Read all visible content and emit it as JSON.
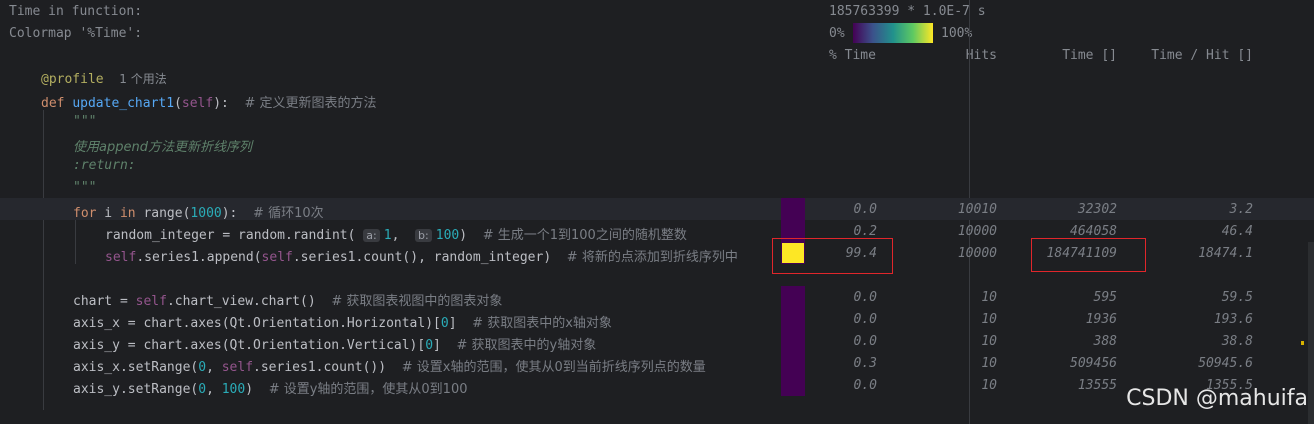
{
  "header": {
    "time_label": "Time in function:",
    "time_value": "185763399 * 1.0E-7 s",
    "colormap_label": "Colormap '%Time':",
    "colormap_min": "0%",
    "colormap_max": "100%"
  },
  "columns": [
    "% Time",
    "Hits",
    "Time []",
    "Time / Hit []"
  ],
  "code": {
    "decorator": "@profile",
    "decorator_hint": "1 个用法",
    "def_kw": "def",
    "func_name": "update_chart1",
    "self_kw": "self",
    "def_comment": "# 定义更新图表的方法",
    "doc_open": "\"\"\"",
    "doc_line": "使用append方法更新折线序列",
    "doc_return": ":return:",
    "doc_close": "\"\"\""
  },
  "rows": [
    {
      "pct": "0.0",
      "hits": "10010",
      "time": "32302",
      "per_hit": "3.2",
      "heat": "#440154"
    },
    {
      "pct": "0.2",
      "hits": "10000",
      "time": "464058",
      "per_hit": "46.4",
      "heat": "#440154"
    },
    {
      "pct": "99.4",
      "hits": "10000",
      "time": "184741109",
      "per_hit": "18474.1",
      "heat": "#fde725"
    },
    {
      "pct": "0.0",
      "hits": "10",
      "time": "595",
      "per_hit": "59.5",
      "heat": "#440154"
    },
    {
      "pct": "0.0",
      "hits": "10",
      "time": "1936",
      "per_hit": "193.6",
      "heat": "#440154"
    },
    {
      "pct": "0.0",
      "hits": "10",
      "time": "388",
      "per_hit": "38.8",
      "heat": "#440154"
    },
    {
      "pct": "0.3",
      "hits": "10",
      "time": "509456",
      "per_hit": "50945.6",
      "heat": "#440154"
    },
    {
      "pct": "0.0",
      "hits": "10",
      "time": "13555",
      "per_hit": "1355.5",
      "heat": "#440154"
    }
  ],
  "line_comments": [
    "# 循环10次",
    "# 生成一个1到100之间的随机整数",
    "# 将新的点添加到折线序列中",
    "# 获取图表视图中的图表对象",
    "# 获取图表中的x轴对象",
    "# 获取图表中的y轴对象",
    "# 设置x轴的范围，使其从0到当前折线序列点的数量",
    "# 设置y轴的范围，使其从0到100"
  ],
  "param_hints": {
    "a": "a:",
    "b": "b:"
  },
  "watermark": "CSDN @mahuifa",
  "colors": {
    "background": "#1e1f22",
    "highlight": "#e0262b"
  }
}
